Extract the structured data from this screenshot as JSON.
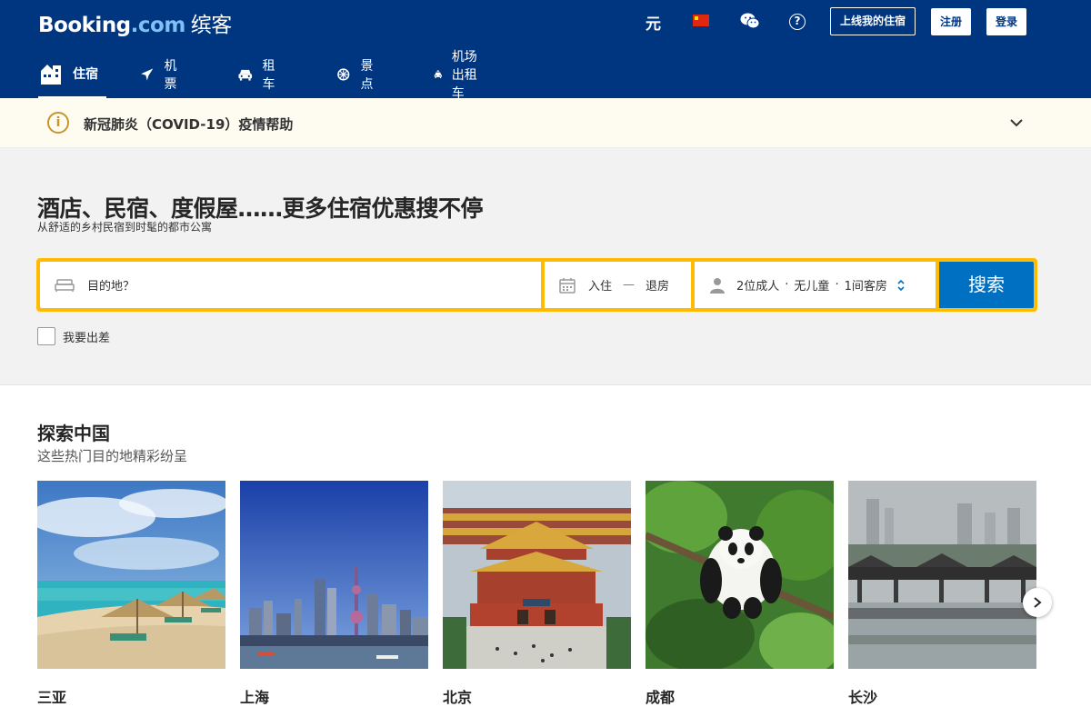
{
  "header": {
    "logo_main": "Booking",
    "logo_dotcom": ".com",
    "logo_cn": "缤客",
    "currency": "元",
    "list_property": "上线我的住宿",
    "register": "注册",
    "login": "登录",
    "help": "?"
  },
  "nav": [
    {
      "label": "住宿",
      "icon": "bed-icon"
    },
    {
      "label": "机票",
      "icon": "plane-icon"
    },
    {
      "label": "租车",
      "icon": "car-icon"
    },
    {
      "label": "景点",
      "icon": "ferris-wheel-icon"
    },
    {
      "label": "机场出租车",
      "icon": "taxi-icon"
    }
  ],
  "covid": {
    "icon": "i",
    "text": "新冠肺炎（COVID-19）疫情帮助"
  },
  "hero": {
    "title": "酒店、民宿、度假屋……更多住宿优惠搜不停",
    "subtitle": "从舒适的乡村民宿到时髦的都市公寓"
  },
  "search": {
    "destination_placeholder": "目的地？",
    "checkin": "入住",
    "dash": "—",
    "checkout": "退房",
    "adults": "2位成人",
    "children": "无儿童",
    "rooms": "1间客房",
    "dot": "·",
    "button": "搜索",
    "business_label": "我要出差"
  },
  "explore": {
    "title": "探索中国",
    "subtitle": "这些热门目的地精彩纷呈",
    "cities": [
      "三亚",
      "上海",
      "北京",
      "成都",
      "长沙"
    ]
  },
  "colors": {
    "brand_blue": "#003580",
    "search_yellow": "#febb02",
    "button_blue": "#0071c2"
  }
}
